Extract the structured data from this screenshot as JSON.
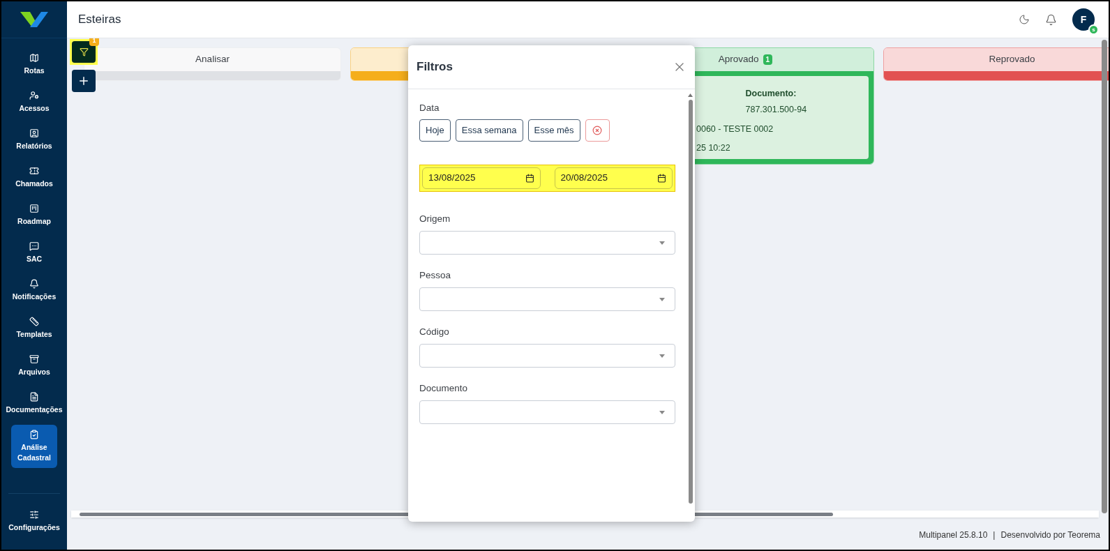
{
  "sidebar": {
    "items": [
      {
        "label": "Rotas",
        "selected": false
      },
      {
        "label": "Acessos",
        "selected": false
      },
      {
        "label": "Relatórios",
        "selected": false
      },
      {
        "label": "Chamados",
        "selected": false
      },
      {
        "label": "Roadmap",
        "selected": false
      },
      {
        "label": "SAC",
        "selected": false
      },
      {
        "label": "Notificações",
        "selected": false
      },
      {
        "label": "Templates",
        "selected": false
      },
      {
        "label": "Arquivos",
        "selected": false
      },
      {
        "label": "Documentações",
        "selected": false
      },
      {
        "label": "Análise Cadastral",
        "selected": true
      }
    ],
    "footer_item": {
      "label": "Configurações"
    }
  },
  "header": {
    "title": "Esteiras",
    "avatar": {
      "initial": "F",
      "status": "s"
    }
  },
  "toolbar": {
    "filter_button": {
      "badge": "1",
      "highlighted": true
    }
  },
  "board": {
    "columns": [
      {
        "title": "Analisar",
        "color": "#dfe1e5"
      },
      {
        "color": "#f5ae1b"
      },
      {
        "title": "Aprovado",
        "badge": "1",
        "color": "#2fb75a",
        "cards": [
          {
            "document_label": "Documento:",
            "document": "787.301.500-94",
            "lines": [
              "0060 - TESTE 0002",
              "25 10:22"
            ]
          }
        ]
      },
      {
        "title": "Reprovado",
        "color": "#e25252"
      }
    ]
  },
  "filters_dialog": {
    "title": "Filtros",
    "date": {
      "label": "Data",
      "quick_buttons": [
        {
          "kind": "text",
          "label": "Hoje"
        },
        {
          "kind": "text",
          "label": "Essa semana"
        },
        {
          "kind": "text",
          "label": "Esse mês"
        },
        {
          "kind": "clear"
        }
      ],
      "range": {
        "highlighted": true,
        "start": "13/08/2025",
        "end": "20/08/2025"
      }
    },
    "selects": [
      {
        "label": "Origem"
      },
      {
        "label": "Pessoa"
      },
      {
        "label": "Código"
      },
      {
        "label": "Documento"
      }
    ]
  },
  "status_bar": {
    "version": "Multipanel  25.8.10",
    "separator": "|",
    "credit": "Desenvolvido por Teorema"
  }
}
